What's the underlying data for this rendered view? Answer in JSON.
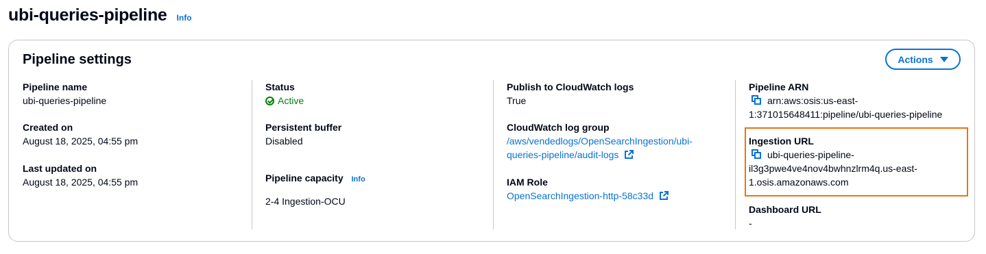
{
  "page": {
    "title": "ubi-queries-pipeline",
    "info_label": "Info"
  },
  "settings": {
    "title": "Pipeline settings",
    "actions_label": "Actions",
    "columns": {
      "col1": {
        "pipeline_name_label": "Pipeline name",
        "pipeline_name_value": "ubi-queries-pipeline",
        "created_on_label": "Created on",
        "created_on_value": "August 18, 2025, 04:55 pm",
        "last_updated_label": "Last updated on",
        "last_updated_value": "August 18, 2025, 04:55 pm"
      },
      "col2": {
        "status_label": "Status",
        "status_value": "Active",
        "buffer_label": "Persistent buffer",
        "buffer_value": "Disabled",
        "capacity_label": "Pipeline capacity",
        "capacity_info": "Info",
        "capacity_value": "2-4 Ingestion-OCU"
      },
      "col3": {
        "publish_label": "Publish to CloudWatch logs",
        "publish_value": "True",
        "log_group_label": "CloudWatch log group",
        "log_group_line1": "/aws/vendedlogs/OpenSearchIngestion/ubi-",
        "log_group_line2": "queries-pipeline/audit-logs",
        "iam_label": "IAM Role",
        "iam_value": "OpenSearchIngestion-http-58c33d"
      },
      "col4": {
        "arn_label": "Pipeline ARN",
        "arn_line1": "arn:aws:osis:us-east-",
        "arn_line2": "1:371015648411:pipeline/ubi-queries-pipeline",
        "ingestion_label": "Ingestion URL",
        "ingestion_line1": "ubi-queries-pipeline-",
        "ingestion_line2": "il3g3pwe4ve4nov4bwhnzlrm4q.us-east-",
        "ingestion_line3": "1.osis.amazonaws.com",
        "dashboard_label": "Dashboard URL",
        "dashboard_value": "-"
      }
    }
  },
  "colors": {
    "link": "#0972d3",
    "success": "#037f0c",
    "highlight": "#ec7211",
    "border": "#c6c6cd"
  },
  "icons": [
    "check-circle-icon",
    "copy-icon",
    "external-link-icon",
    "caret-down-icon"
  ]
}
